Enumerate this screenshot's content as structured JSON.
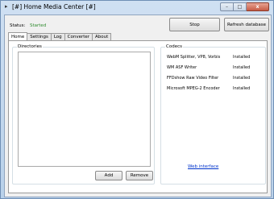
{
  "window": {
    "title": "[#] Home Media Center [#]",
    "icon": "app-icon",
    "controls": {
      "minimize": "–",
      "maximize": "□",
      "close": "x"
    }
  },
  "status": {
    "label": "Status:",
    "value": "Started",
    "value_color": "#2e8b2e"
  },
  "toolbar": {
    "stop_label": "Stop",
    "refresh_label": "Refresh database"
  },
  "tabs": [
    {
      "label": "Home",
      "active": true
    },
    {
      "label": "Settings",
      "active": false
    },
    {
      "label": "Log",
      "active": false
    },
    {
      "label": "Converter",
      "active": false
    },
    {
      "label": "About",
      "active": false
    }
  ],
  "directories": {
    "title": "Directories",
    "items": [],
    "add_label": "Add",
    "remove_label": "Remove"
  },
  "codecs": {
    "title": "Codecs",
    "items": [
      {
        "name": "WebM Splitter, VP8, Vorbis",
        "status": "Installed"
      },
      {
        "name": "WM ASF Writer",
        "status": "Installed"
      },
      {
        "name": "FFDshow Raw Video Filter",
        "status": "Installed"
      },
      {
        "name": "Microsoft MPEG-2 Encoder",
        "status": "Installed"
      }
    ]
  },
  "web_interface_label": "Web interface",
  "link_color": "#0033cc"
}
